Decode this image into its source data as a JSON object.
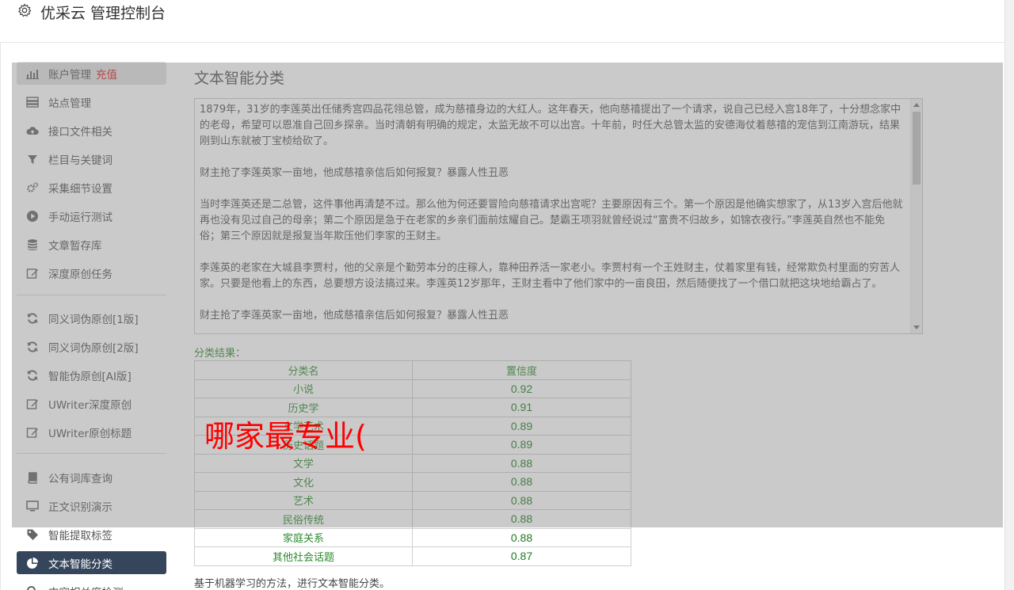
{
  "header": {
    "title": "优采云 管理控制台",
    "icon": "gear-icon"
  },
  "sidebar": {
    "items": [
      {
        "label": "账户管理",
        "extra": "充值",
        "icon": "bar-chart-icon"
      },
      {
        "label": "站点管理",
        "icon": "server-icon"
      },
      {
        "label": "接口文件相关",
        "icon": "cloud-upload-icon"
      },
      {
        "label": "栏目与关键词",
        "icon": "filter-icon"
      },
      {
        "label": "采集细节设置",
        "icon": "cogs-icon"
      },
      {
        "label": "手动运行测试",
        "icon": "play-circle-icon"
      },
      {
        "label": "文章暂存库",
        "icon": "database-icon"
      },
      {
        "label": "深度原创任务",
        "icon": "edit-icon"
      },
      {
        "label": "同义词伪原创[1版]",
        "icon": "refresh-icon"
      },
      {
        "label": "同义词伪原创[2版]",
        "icon": "refresh-icon"
      },
      {
        "label": "智能伪原创[AI版]",
        "icon": "refresh-icon"
      },
      {
        "label": "UWriter深度原创",
        "icon": "edit-icon"
      },
      {
        "label": "UWriter原创标题",
        "icon": "edit-icon"
      },
      {
        "label": "公有词库查询",
        "icon": "book-icon"
      },
      {
        "label": "正文识别演示",
        "icon": "monitor-icon"
      },
      {
        "label": "智能提取标签",
        "icon": "tag-icon"
      },
      {
        "label": "文本智能分类",
        "icon": "pie-chart-icon"
      },
      {
        "label": "内容相关度检测",
        "icon": "search-icon"
      }
    ],
    "active_label": "文本智能分类"
  },
  "main": {
    "title": "文本智能分类",
    "text_paragraphs": [
      "1879年，31岁的李莲英出任储秀宫四品花翎总管，成为慈禧身边的大红人。这年春天，他向慈禧提出了一个请求，说自己已经入宫18年了，十分想念家中的老母，希望可以恩准自己回乡探亲。当时清朝有明确的规定，太监无故不可以出宫。十年前，时任大总管太监的安德海仗着慈禧的宠信到江南游玩，结果刚到山东就被丁宝桢给砍了。",
      "财主抢了李莲英家一亩地，他成慈禧亲信后如何报复？暴露人性丑恶",
      "当时李莲英还是二总管，这件事他再清楚不过。那么他为何还要冒险向慈禧请求出宫呢？主要原因有三个。第一个原因是他确实想家了，从13岁入宫后他就再也没有见过自己的母亲；第二个原因是急于在老家的乡亲们面前炫耀自己。楚霸王项羽就曾经说过“富贵不归故乡，如锦衣夜行。”李莲英自然也不能免俗；第三个原因就是报复当年欺压他们李家的王财主。",
      "李莲英的老家在大城县李贾村，他的父亲是个勤劳本分的庄稼人，靠种田养活一家老小。李贾村有一个王姓财主，仗着家里有钱，经常欺负村里面的穷苦人家。只要是他看上的东西，总要想方设法搞过来。李莲英12岁那年，王财主看中了他们家中的一亩良田，然后随便找了一个借口就把这块地给霸占了。",
      "财主抢了李莲英家一亩地，他成慈禧亲信后如何报复？暴露人性丑恶"
    ],
    "result_label": "分类结果：",
    "table": {
      "headers": [
        "分类名",
        "置信度"
      ],
      "rows": [
        [
          "小说",
          "0.92"
        ],
        [
          "历史学",
          "0.91"
        ],
        [
          "文学艺术",
          "0.89"
        ],
        [
          "历史话题",
          "0.89"
        ],
        [
          "文学",
          "0.88"
        ],
        [
          "文化",
          "0.88"
        ],
        [
          "艺术",
          "0.88"
        ],
        [
          "民俗传统",
          "0.88"
        ],
        [
          "家庭关系",
          "0.88"
        ],
        [
          "其他社会话题",
          "0.87"
        ]
      ]
    },
    "footer_note": "基于机器学习的方法，进行文本智能分类。"
  },
  "overlay": {
    "text": "哪家最专业("
  },
  "colors": {
    "accent_dark": "#35465c",
    "recharge_red": "#e02020",
    "result_green": "#2e8b2e",
    "overlay_red": "#ff0000"
  }
}
